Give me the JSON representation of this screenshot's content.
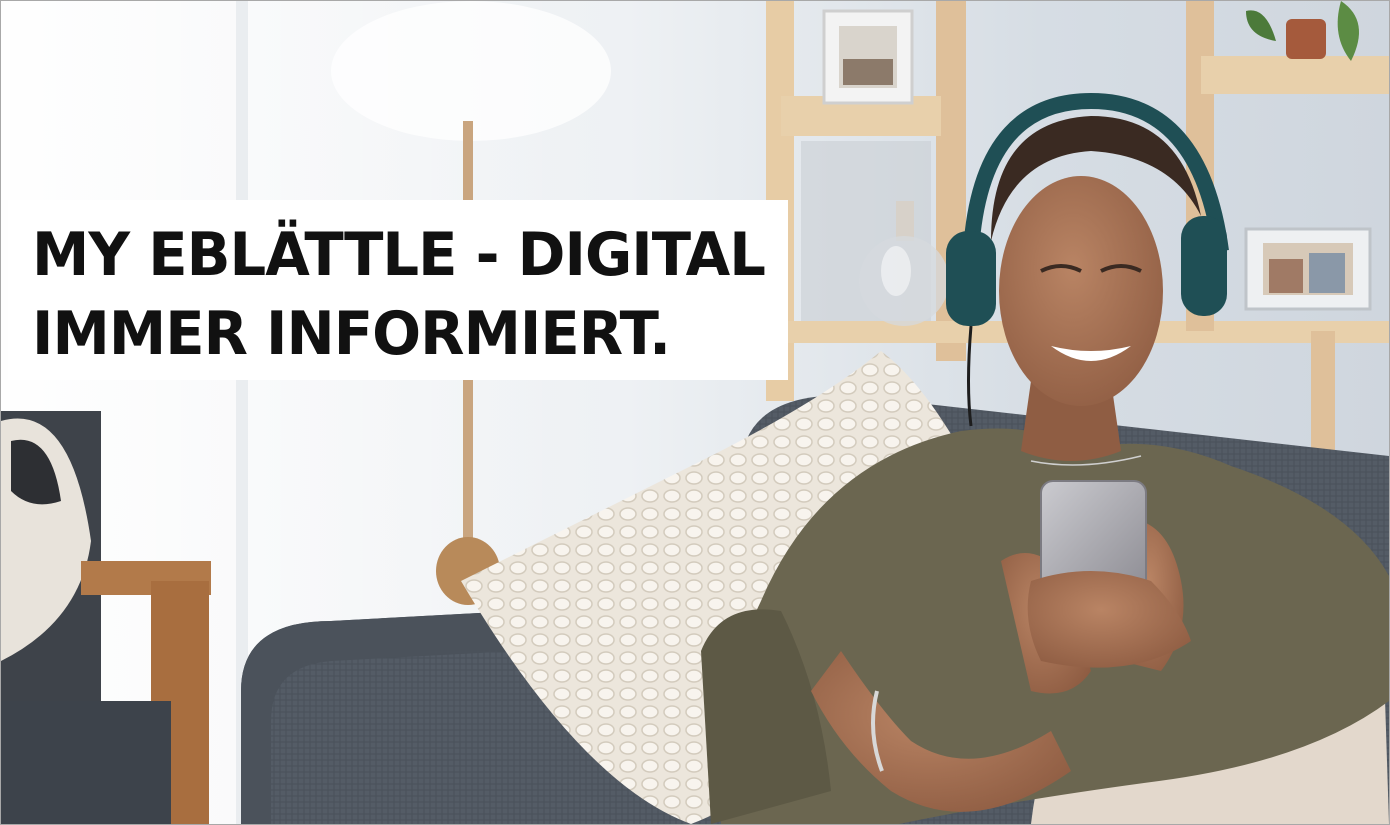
{
  "headline": {
    "line1": "MY EBLÄTTLE - DIGITAL",
    "line2": "IMMER INFORMIERT."
  },
  "photo": {
    "subject": "woman-with-headphones-using-smartphone-on-sofa"
  },
  "colors": {
    "headline_text": "#111111",
    "headline_background": "#ffffff",
    "wall": "#dfe5ea",
    "shelf_wood": "#e3c8a2",
    "sofa": "#525a63",
    "pillow": "#ece6dc",
    "shirt": "#6b6650",
    "headphones": "#1f4f55"
  }
}
